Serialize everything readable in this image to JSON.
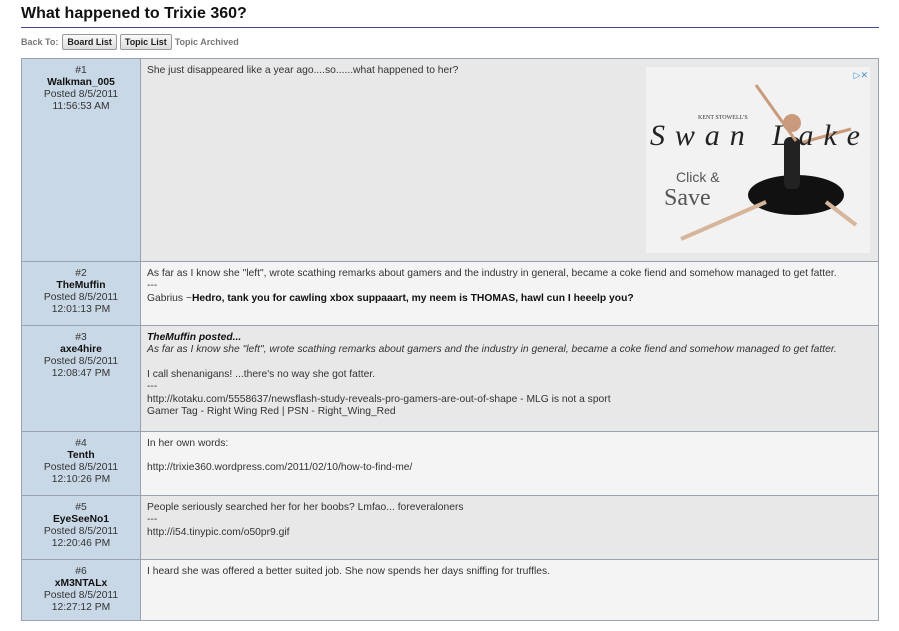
{
  "page": {
    "title": "What happened to Trixie 360?"
  },
  "nav": {
    "back_label": "Back To:",
    "board_list": "Board List",
    "topic_list": "Topic List",
    "status": "Topic Archived"
  },
  "ad": {
    "brand": "KENT STOWELL'S",
    "headline": "Swan Lake",
    "cta_top": "Click &",
    "cta_bottom": "Save",
    "icons": "▷✕"
  },
  "posts": [
    {
      "num": "#1",
      "user": "Walkman_005",
      "posted": "Posted 8/5/2011",
      "time": "11:56:53 AM",
      "line1": "She just disappeared like a year ago....so......what happened to her?"
    },
    {
      "num": "#2",
      "user": "TheMuffin",
      "posted": "Posted 8/5/2011",
      "time": "12:01:13 PM",
      "line1": "As far as I know she \"left\", wrote scathing remarks about gamers and the industry in general, became a coke fiend and somehow managed to get fatter.",
      "sep": "---",
      "sig_prefix": "Gabrius ~",
      "sig_bold": "Hedro, tank you for cawling xbox suppaaart, my neem is THOMAS, hawl cun I heeelp you?"
    },
    {
      "num": "#3",
      "user": "axe4hire",
      "posted": "Posted 8/5/2011",
      "time": "12:08:47 PM",
      "quote_head": "TheMuffin posted...",
      "quote_body": "As far as I know she \"left\", wrote scathing remarks about gamers and the industry in general, became a coke fiend and somehow managed to get fatter.",
      "line1": "I call shenanigans! ...there's no way she got fatter.",
      "sep": "---",
      "sig1": "http://kotaku.com/5558637/newsflash-study-reveals-pro-gamers-are-out-of-shape - MLG is not a sport",
      "sig2": "Gamer Tag - Right Wing Red | PSN - Right_Wing_Red"
    },
    {
      "num": "#4",
      "user": "Tenth",
      "posted": "Posted 8/5/2011",
      "time": "12:10:26 PM",
      "line1": "In her own words:",
      "line2": "http://trixie360.wordpress.com/2011/02/10/how-to-find-me/"
    },
    {
      "num": "#5",
      "user": "EyeSeeNo1",
      "posted": "Posted 8/5/2011",
      "time": "12:20:46 PM",
      "line1": "People seriously searched her for her boobs? Lmfao... foreveraloners",
      "sep": "---",
      "sig1": "http://i54.tinypic.com/o50pr9.gif"
    },
    {
      "num": "#6",
      "user": "xM3NTALx",
      "posted": "Posted 8/5/2011",
      "time": "12:27:12 PM",
      "line1": "I heard she was offered a better suited job. She now spends her days sniffing for truffles."
    }
  ]
}
